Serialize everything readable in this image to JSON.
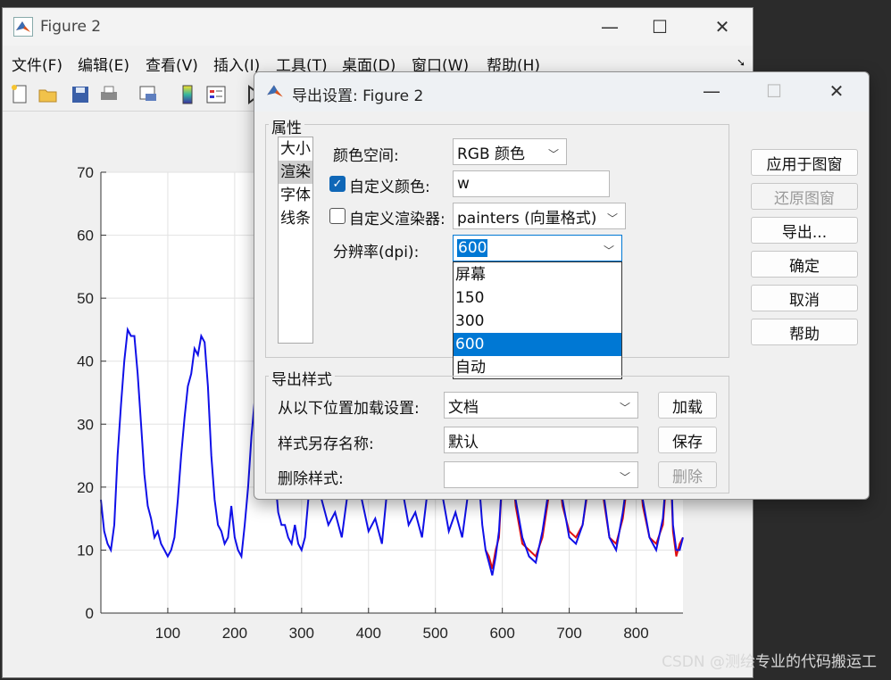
{
  "figure_window": {
    "title": "Figure 2",
    "menu": [
      "文件(F)",
      "编辑(E)",
      "查看(V)",
      "插入(I)",
      "工具(T)",
      "桌面(D)",
      "窗口(W)",
      "帮助(H)"
    ],
    "toolbar_icons": [
      "new-file-icon",
      "open-folder-icon",
      "save-icon",
      "print-icon",
      "link-icon",
      "colorbar-icon",
      "legend-icon",
      "play-icon"
    ]
  },
  "chart_data": {
    "type": "line",
    "xlim": [
      0,
      870
    ],
    "ylim": [
      0,
      70
    ],
    "x_ticks": [
      100,
      200,
      300,
      400,
      500,
      600,
      700,
      800
    ],
    "y_ticks": [
      0,
      10,
      20,
      30,
      40,
      50,
      60,
      70
    ],
    "grid": true,
    "series": [
      {
        "color": "#1010e8",
        "x": [
          0,
          5,
          10,
          15,
          20,
          25,
          30,
          35,
          40,
          45,
          50,
          55,
          60,
          65,
          70,
          75,
          80,
          85,
          90,
          95,
          100,
          105,
          110,
          115,
          120,
          125,
          130,
          135,
          140,
          145,
          150,
          155,
          160,
          165,
          170,
          175,
          180,
          185,
          190,
          195,
          200,
          205,
          210,
          215,
          220,
          225,
          230,
          235,
          240,
          245,
          250,
          255,
          260,
          265,
          270,
          275,
          280,
          285,
          290,
          295,
          300,
          305,
          310,
          315,
          320,
          330,
          340,
          350,
          360,
          370,
          380,
          390,
          400,
          410,
          420,
          430,
          440,
          450,
          460,
          470,
          480,
          490,
          500,
          510,
          520,
          530,
          540,
          550,
          560,
          570,
          575,
          580,
          585,
          590,
          595,
          600,
          610,
          620,
          630,
          640,
          650,
          660,
          670,
          680,
          690,
          700,
          710,
          720,
          730,
          740,
          750,
          760,
          770,
          780,
          790,
          800,
          810,
          820,
          830,
          840,
          845,
          850,
          855,
          860,
          865,
          870
        ],
        "values": [
          18,
          13,
          11,
          10,
          14,
          25,
          33,
          40,
          45,
          44,
          44,
          38,
          30,
          22,
          17,
          15,
          12,
          13,
          11,
          10,
          9,
          10,
          12,
          18,
          25,
          31,
          36,
          38,
          42,
          41,
          44,
          43,
          36,
          25,
          18,
          14,
          13,
          11,
          12,
          17,
          12,
          10,
          9,
          14,
          20,
          28,
          34,
          40,
          39,
          42,
          38,
          30,
          22,
          16,
          14,
          14,
          12,
          11,
          14,
          11,
          10,
          12,
          18,
          26,
          30,
          18,
          14,
          16,
          12,
          20,
          28,
          18,
          13,
          15,
          11,
          22,
          30,
          20,
          14,
          16,
          12,
          21,
          29,
          19,
          13,
          16,
          12,
          20,
          28,
          14,
          10,
          8,
          6,
          9,
          13,
          22,
          30,
          18,
          12,
          9,
          8,
          13,
          20,
          27,
          18,
          12,
          11,
          14,
          22,
          30,
          20,
          12,
          10,
          16,
          24,
          30,
          18,
          12,
          10,
          15,
          22,
          30,
          14,
          10,
          10,
          12
        ]
      },
      {
        "color": "#e01010",
        "x": [
          575,
          580,
          585,
          590,
          595,
          600,
          610,
          620,
          630,
          640,
          650,
          660,
          670,
          680,
          690,
          700,
          710,
          720,
          730,
          740,
          750,
          760,
          770,
          780,
          790,
          800,
          810,
          820,
          830,
          840,
          845,
          850,
          855,
          860,
          865,
          870
        ],
        "values": [
          10,
          9,
          7,
          10,
          12,
          22,
          29,
          17,
          11,
          10,
          9,
          12,
          19,
          26,
          17,
          13,
          12,
          14,
          21,
          28,
          19,
          12,
          11,
          15,
          23,
          29,
          17,
          12,
          11,
          14,
          21,
          28,
          13,
          9,
          11,
          12
        ]
      }
    ]
  },
  "dialog": {
    "title": "导出设置: Figure 2",
    "properties_label": "属性",
    "list_items": [
      "大小",
      "渲染",
      "字体",
      "线条"
    ],
    "selected_list_index": 1,
    "color_space_label": "颜色空间:",
    "color_space_value": "RGB 颜色",
    "custom_color_label": "自定义颜色:",
    "custom_color_checked": true,
    "custom_color_value": "w",
    "custom_renderer_label": "自定义渲染器:",
    "custom_renderer_checked": false,
    "renderer_value": "painters (向量格式)",
    "dpi_label": "分辨率(dpi):",
    "dpi_value": "600",
    "dpi_options": [
      "屏幕",
      "150",
      "300",
      "600",
      "自动"
    ],
    "dpi_selected_index": 3,
    "buttons": {
      "apply": "应用于图窗",
      "restore": "还原图窗",
      "export": "导出...",
      "ok": "确定",
      "cancel": "取消",
      "help": "帮助"
    },
    "export_styles_label": "导出样式",
    "load_from_label": "从以下位置加载设置:",
    "load_from_value": "文档",
    "load_button": "加载",
    "save_as_label": "样式另存名称:",
    "save_as_value": "默认",
    "save_button": "保存",
    "delete_label": "删除样式:",
    "delete_value": "",
    "delete_button": "删除"
  },
  "watermark": "CSDN @测绘专业的代码搬运工"
}
